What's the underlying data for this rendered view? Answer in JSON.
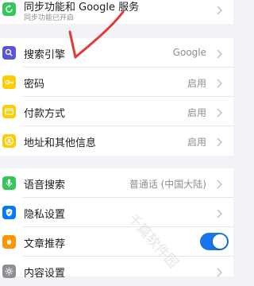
{
  "sync": {
    "label": "同步功能和 Google 服务",
    "sublabel": "同步功能已开启"
  },
  "group1": [
    {
      "label": "搜索引擎",
      "value": "Google",
      "icon": "search-icon",
      "color": "#5856d6"
    },
    {
      "label": "密码",
      "value": "启用",
      "icon": "key-icon",
      "color": "#ffcc00"
    },
    {
      "label": "付款方式",
      "value": "启用",
      "icon": "card-icon",
      "color": "#ffcc00"
    },
    {
      "label": "地址和其他信息",
      "value": "启用",
      "icon": "person-icon",
      "color": "#ffcc00"
    }
  ],
  "group2": [
    {
      "label": "语音搜索",
      "value": "普通话 (中国大陆)",
      "icon": "mic-icon",
      "color": "#34c759"
    },
    {
      "label": "隐私设置",
      "value": "",
      "icon": "shield-icon",
      "color": "#007aff"
    },
    {
      "label": "文章推荐",
      "toggle": true,
      "icon": "flame-icon",
      "color": "#ff9500"
    },
    {
      "label": "内容设置",
      "value": "",
      "icon": "gear-icon",
      "color": "#8e8e93"
    }
  ],
  "watermark": "千篇软件园"
}
